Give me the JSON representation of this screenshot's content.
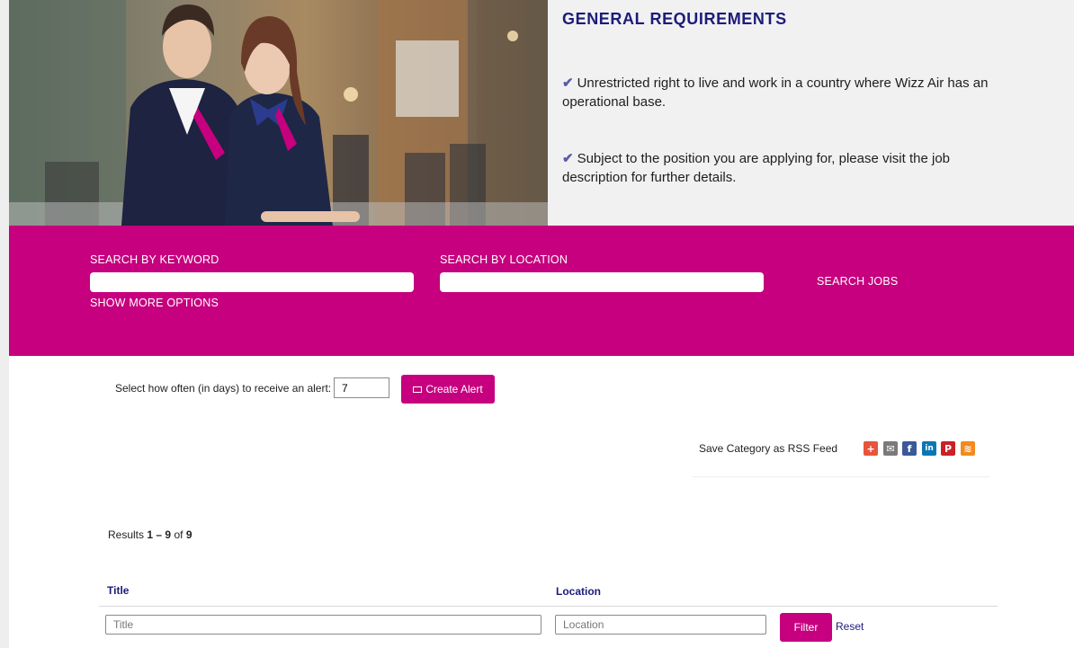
{
  "hero": {
    "requirements_title": "GENERAL REQUIREMENTS",
    "requirements": [
      "Unrestricted right to live and work in a country where Wizz Air has an operational base.",
      "Subject to the position you are applying for, please visit the job description for further details."
    ]
  },
  "search": {
    "keyword_label": "SEARCH BY KEYWORD",
    "location_label": "SEARCH BY LOCATION",
    "keyword_value": "",
    "location_value": "",
    "search_button": "SEARCH JOBS",
    "more_options": "SHOW MORE OPTIONS"
  },
  "alert": {
    "label": "Select how often (in days) to receive an alert:",
    "days_value": "7",
    "button": "Create Alert"
  },
  "rss": {
    "label": "Save Category as RSS Feed",
    "icons": [
      "share-plus-icon",
      "email-icon",
      "facebook-icon",
      "linkedin-icon",
      "pinterest-icon",
      "rss-icon"
    ]
  },
  "results": {
    "prefix": "Results",
    "start": "1",
    "dash": "–",
    "end": "9",
    "of": "of",
    "total": "9"
  },
  "table": {
    "col_title": "Title",
    "col_location": "Location",
    "filter_title_placeholder": "Title",
    "filter_location_placeholder": "Location",
    "filter_button": "Filter",
    "reset_link": "Reset"
  },
  "colors": {
    "brand_magenta": "#c6007e",
    "navy_text": "#1c1c7a",
    "panel_grey": "#f1f1f2"
  }
}
